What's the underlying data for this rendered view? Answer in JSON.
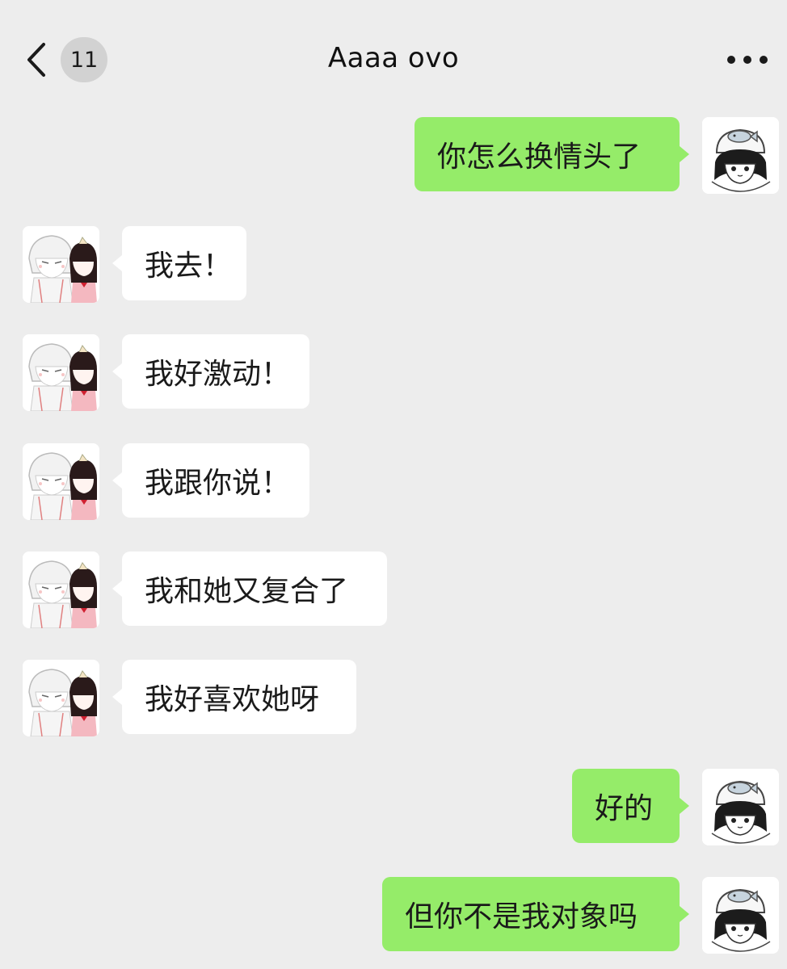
{
  "header": {
    "badge_count": "11",
    "title": "Aaaa  ovo"
  },
  "messages": [
    {
      "sender": "self",
      "text": "你怎么换情头了"
    },
    {
      "sender": "contact",
      "text": "我去！"
    },
    {
      "sender": "contact",
      "text": "我好激动！"
    },
    {
      "sender": "contact",
      "text": "我跟你说！"
    },
    {
      "sender": "contact",
      "text": "我和她又复合了"
    },
    {
      "sender": "contact",
      "text": "我好喜欢她呀"
    },
    {
      "sender": "self",
      "text": "好的"
    },
    {
      "sender": "self",
      "text": "但你不是我对象吗"
    }
  ],
  "colors": {
    "background": "#ededed",
    "outgoing_bubble": "#95ec69",
    "incoming_bubble": "#ffffff"
  },
  "icons": {
    "back": "chevron-left-icon",
    "more": "more-dots-icon"
  }
}
